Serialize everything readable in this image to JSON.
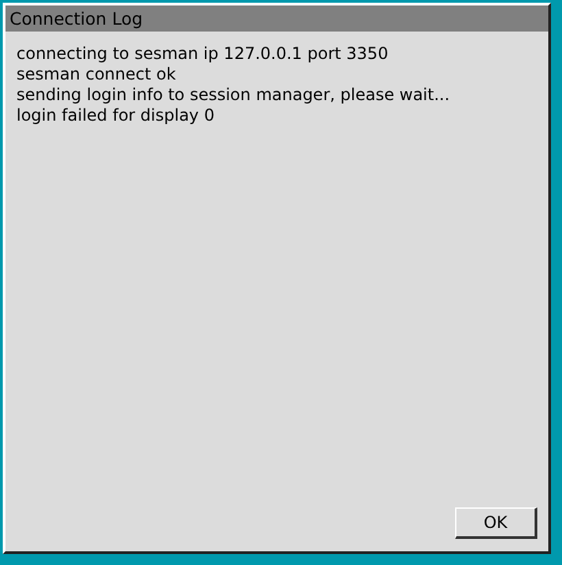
{
  "window": {
    "title": "Connection Log"
  },
  "log_lines": [
    "connecting to sesman ip 127.0.0.1 port 3350",
    "sesman connect ok",
    "sending login info to session manager, please wait...",
    "login failed for display 0"
  ],
  "buttons": [
    "OK"
  ]
}
